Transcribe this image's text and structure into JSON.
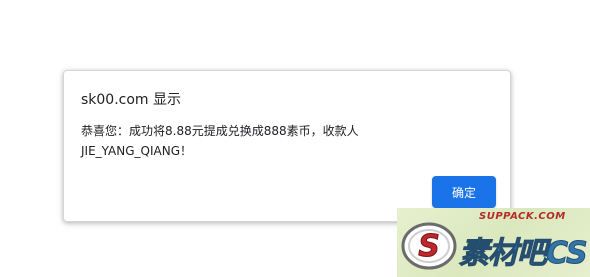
{
  "dialog": {
    "title": "sk00.com 显示",
    "message_lines": [
      "恭喜您：成功将8.88元提成兑换成888素币，收款人",
      "JIE_YANG_QIANG！"
    ],
    "ok_label": "确定"
  },
  "watermark": {
    "url": "SUPPACK.COM",
    "brand": "素材吧CS",
    "logo_letter": "S"
  },
  "colors": {
    "button_bg": "#1a73e8",
    "button_text": "#ffffff",
    "dialog_text": "#202124",
    "watermark_red": "#b52a2a",
    "watermark_blue": "#1e6aa8"
  }
}
